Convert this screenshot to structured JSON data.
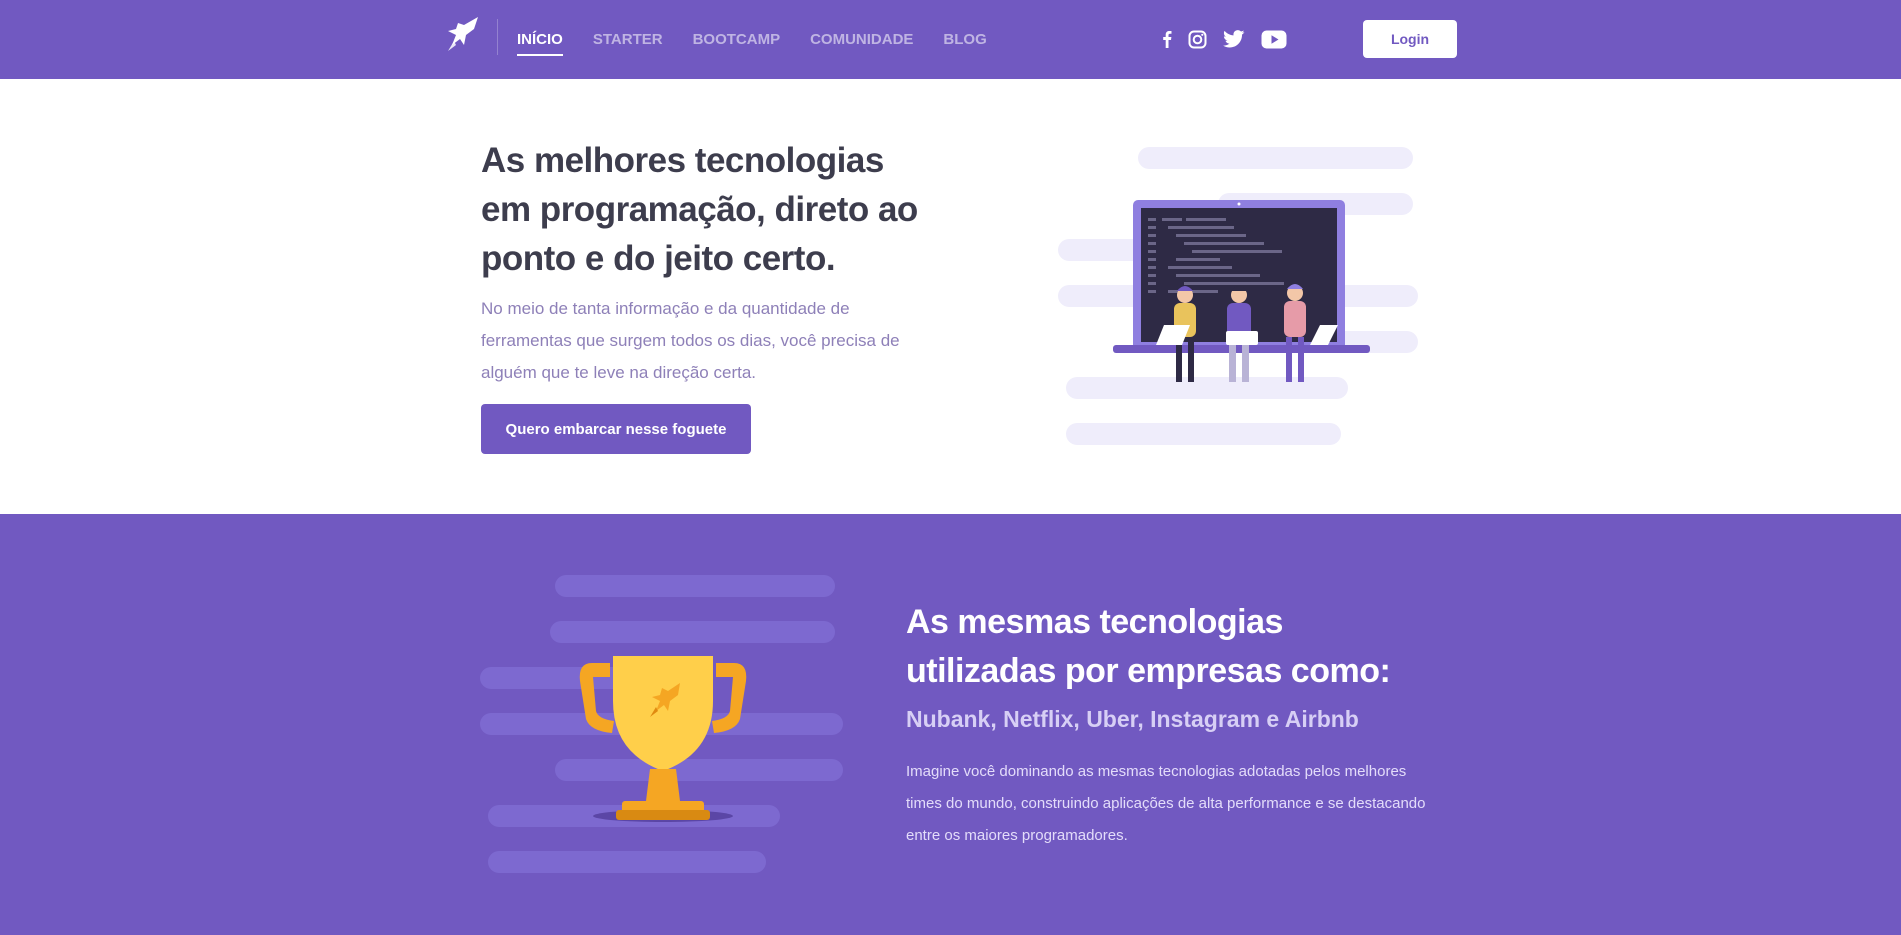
{
  "header": {
    "logo_icon": "rocket-icon",
    "nav": [
      {
        "label": "INÍCIO",
        "active": true
      },
      {
        "label": "STARTER",
        "active": false
      },
      {
        "label": "BOOTCAMP",
        "active": false
      },
      {
        "label": "COMUNIDADE",
        "active": false
      },
      {
        "label": "BLOG",
        "active": false
      }
    ],
    "social": [
      "facebook-icon",
      "instagram-icon",
      "twitter-icon",
      "youtube-icon"
    ],
    "login_label": "Login",
    "brand_color": "#7159c1"
  },
  "hero": {
    "title": "As melhores tecnologias em programação, direto ao ponto e do jeito certo.",
    "description": "No meio de tanta informação e da quantidade de ferramentas que surgem todos os dias, você precisa de alguém que te leve na direção certa.",
    "cta_label": "Quero embarcar nesse foguete",
    "illustration": "developers-laptop-illustration"
  },
  "companies": {
    "title": "As mesmas tecnologias utilizadas por empresas como:",
    "subtitle": "Nubank, Netflix, Uber, Instagram e Airbnb",
    "description": "Imagine você dominando as mesmas tecnologias adotadas pelos melhores times do mundo, construindo aplicações de alta performance e se destacando entre os maiores programadores.",
    "illustration": "trophy-illustration"
  }
}
